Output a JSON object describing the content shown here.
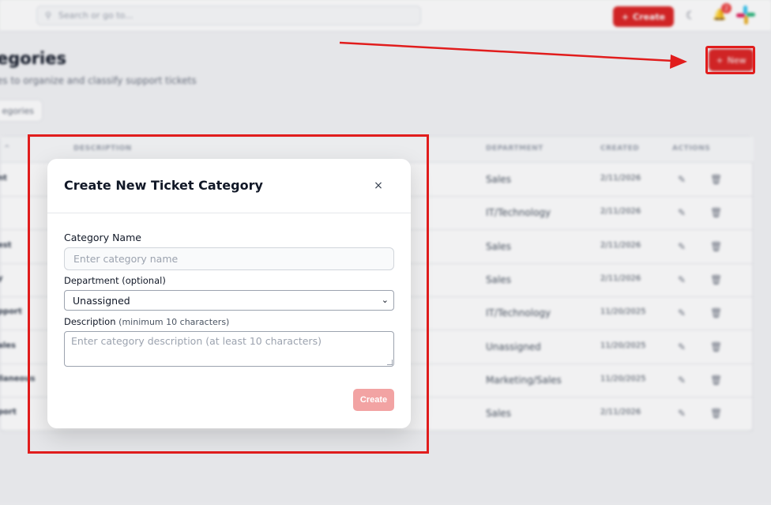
{
  "topbar": {
    "search_placeholder": "Search or go to...",
    "create_label": "Create",
    "create_icon": "+",
    "notification_count": "2"
  },
  "page": {
    "title": "egories",
    "subtitle": "es to organize and classify support tickets",
    "new_label": "New",
    "new_icon": "+",
    "tab_label": "egories"
  },
  "table": {
    "headers": {
      "name": "^",
      "description": "DESCRIPTION",
      "department": "DEPARTMENT",
      "created": "CREATED",
      "actions": "ACTIONS"
    },
    "rows": [
      {
        "name": "nt",
        "department": "Sales",
        "created": "2/11/2026"
      },
      {
        "name": "",
        "department": "IT/Technology",
        "created": "2/11/2026"
      },
      {
        "name": "est",
        "department": "Sales",
        "created": "2/11/2026"
      },
      {
        "name": "y",
        "department": "Sales",
        "created": "2/11/2026"
      },
      {
        "name": "pport",
        "department": "IT/Technology",
        "created": "11/20/2025"
      },
      {
        "name": "ales",
        "department": "Unassigned",
        "created": "11/20/2025"
      },
      {
        "name": "llaneous",
        "department": "Marketing/Sales",
        "created": "11/20/2025"
      },
      {
        "name": "port",
        "department": "Sales",
        "created": "2/11/2026"
      }
    ]
  },
  "modal": {
    "title": "Create New Ticket Category",
    "close_glyph": "×",
    "name_label": "Category Name",
    "name_placeholder": "Enter category name",
    "department_label": "Department (optional)",
    "department_value": "Unassigned",
    "description_label": "Description",
    "description_hint": "(minimum 10 characters)",
    "description_placeholder": "Enter category description (at least 10 characters)",
    "create_label": "Create"
  },
  "colors": {
    "accent": "#dc2626",
    "annotation": "#e11d1d",
    "create_disabled": "#f2a3a3"
  }
}
